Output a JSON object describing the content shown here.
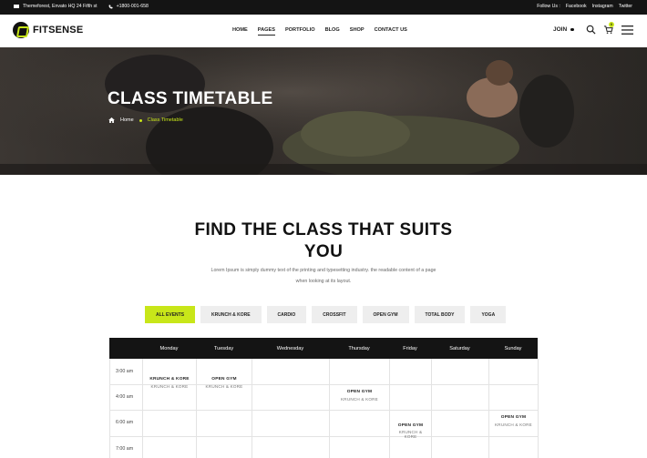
{
  "topbar": {
    "address": "Themeforest, Envato HQ 24 Fifth st",
    "phone": "+1800-001-658",
    "follow_label": "Follow Us :",
    "social": [
      "Facebook",
      "Instagram",
      "Twitter"
    ]
  },
  "header": {
    "logo_text": "FITSENSE",
    "nav": [
      "HOME",
      "PAGES",
      "PORTFOLIO",
      "BLOG",
      "SHOP",
      "CONTACT US"
    ],
    "active_nav": "PAGES",
    "join_label": "JOIN",
    "cart_count": "0"
  },
  "hero": {
    "title": "CLASS TIMETABLE",
    "breadcrumb_home": "Home",
    "breadcrumb_current": "Class Timetable"
  },
  "section": {
    "title_line1": "FIND THE CLASS THAT SUITS",
    "title_line2": "YOU",
    "desc_line1": "Lorem Ipsum is simply dummy text of the printing and typesetting industry. the readable content of a page",
    "desc_line2": "when looking at its layout."
  },
  "filters": [
    "ALL EVENTS",
    "KRUNCH & KORE",
    "CARDIO",
    "CROSSFIT",
    "OPEN GYM",
    "TOTAL BODY",
    "YOGA"
  ],
  "active_filter": "ALL EVENTS",
  "timetable": {
    "days": [
      "Monday",
      "Tuesday",
      "Wednesday",
      "Thursday",
      "Friday",
      "Saturday",
      "Sunday"
    ],
    "times": [
      "3:00 am",
      "4:00 am",
      "6:00 am",
      "7:00 am"
    ],
    "events": [
      {
        "day": "Monday",
        "name": "KRUNCH & KORE",
        "sub": "KRUNCH & KORE"
      },
      {
        "day": "Tuesday",
        "name": "OPEN GYM",
        "sub": "KRUNCH & KORE"
      },
      {
        "day": "Thursday",
        "name": "OPEN GYM",
        "sub": "KRUNCH & KORE"
      },
      {
        "day": "Friday",
        "name": "OPEN GYM",
        "sub": "KRUNCH & KORE"
      },
      {
        "day": "Sunday",
        "name": "OPEN GYM",
        "sub": "KRUNCH & KORE"
      }
    ]
  },
  "colors": {
    "accent": "#c8e619",
    "dark": "#141414"
  }
}
